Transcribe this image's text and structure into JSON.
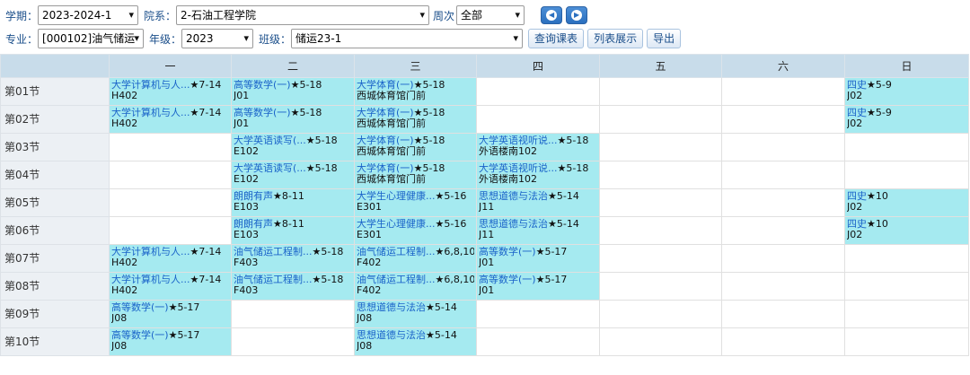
{
  "filters": {
    "term_label": "学期：",
    "term_value": "2023-2024-1",
    "dept_label": "院系：",
    "dept_value": "2-石油工程学院",
    "week_label": "周次",
    "week_value": "全部",
    "major_label": "专业：",
    "major_value": "[000102]油气储运",
    "grade_label": "年级：",
    "grade_value": "2023",
    "class_label": "班级：",
    "class_value": "储运23-1",
    "arrow": "▾"
  },
  "buttons": {
    "prev": "◀",
    "next": "▶",
    "query": "查询课表",
    "list": "列表展示",
    "export": "导出"
  },
  "timetable": {
    "days": [
      "",
      "一",
      "二",
      "三",
      "四",
      "五",
      "六",
      "日"
    ],
    "sections": [
      "第01节",
      "第02节",
      "第03节",
      "第04节",
      "第05节",
      "第06节",
      "第07节",
      "第08节",
      "第09节",
      "第10节"
    ],
    "rows": [
      [
        {
          "course": "大学计算机与人...",
          "weeks": "★7-14",
          "room": "H402"
        },
        {
          "course": "高等数学(一)",
          "weeks": "★5-18",
          "room": "J01"
        },
        {
          "course": "大学体育(一)",
          "weeks": "★5-18",
          "room": "西城体育馆门前"
        },
        null,
        null,
        null,
        {
          "course": "四史",
          "weeks": "★5-9",
          "room": "J02"
        }
      ],
      [
        {
          "course": "大学计算机与人...",
          "weeks": "★7-14",
          "room": "H402"
        },
        {
          "course": "高等数学(一)",
          "weeks": "★5-18",
          "room": "J01"
        },
        {
          "course": "大学体育(一)",
          "weeks": "★5-18",
          "room": "西城体育馆门前"
        },
        null,
        null,
        null,
        {
          "course": "四史",
          "weeks": "★5-9",
          "room": "J02"
        }
      ],
      [
        null,
        {
          "course": "大学英语读写(...",
          "weeks": "★5-18",
          "room": "E102"
        },
        {
          "course": "大学体育(一)",
          "weeks": "★5-18",
          "room": "西城体育馆门前"
        },
        {
          "course": "大学英语视听说...",
          "weeks": "★5-18",
          "room": "外语楼南102"
        },
        null,
        null,
        null
      ],
      [
        null,
        {
          "course": "大学英语读写(...",
          "weeks": "★5-18",
          "room": "E102"
        },
        {
          "course": "大学体育(一)",
          "weeks": "★5-18",
          "room": "西城体育馆门前"
        },
        {
          "course": "大学英语视听说...",
          "weeks": "★5-18",
          "room": "外语楼南102"
        },
        null,
        null,
        null
      ],
      [
        null,
        {
          "course": "朗朗有声",
          "weeks": "★8-11",
          "room": "E103"
        },
        {
          "course": "大学生心理健康...",
          "weeks": "★5-16",
          "room": "E301"
        },
        {
          "course": "思想道德与法治",
          "weeks": "★5-14",
          "room": "J11"
        },
        null,
        null,
        {
          "course": "四史",
          "weeks": "★10",
          "room": "J02"
        }
      ],
      [
        null,
        {
          "course": "朗朗有声",
          "weeks": "★8-11",
          "room": "E103"
        },
        {
          "course": "大学生心理健康...",
          "weeks": "★5-16",
          "room": "E301"
        },
        {
          "course": "思想道德与法治",
          "weeks": "★5-14",
          "room": "J11"
        },
        null,
        null,
        {
          "course": "四史",
          "weeks": "★10",
          "room": "J02"
        }
      ],
      [
        {
          "course": "大学计算机与人...",
          "weeks": "★7-14",
          "room": "H402"
        },
        {
          "course": "油气储运工程制...",
          "weeks": "★5-18",
          "room": "F403"
        },
        {
          "course": "油气储运工程制...",
          "weeks": "★6,8,10",
          "room": "F402"
        },
        {
          "course": "高等数学(一)",
          "weeks": "★5-17",
          "room": "J01"
        },
        null,
        null,
        null
      ],
      [
        {
          "course": "大学计算机与人...",
          "weeks": "★7-14",
          "room": "H402"
        },
        {
          "course": "油气储运工程制...",
          "weeks": "★5-18",
          "room": "F403"
        },
        {
          "course": "油气储运工程制...",
          "weeks": "★6,8,10",
          "room": "F402"
        },
        {
          "course": "高等数学(一)",
          "weeks": "★5-17",
          "room": "J01"
        },
        null,
        null,
        null
      ],
      [
        {
          "course": "高等数学(一)",
          "weeks": "★5-17",
          "room": "J08"
        },
        null,
        {
          "course": "思想道德与法治",
          "weeks": "★5-14",
          "room": "J08"
        },
        null,
        null,
        null,
        null
      ],
      [
        {
          "course": "高等数学(一)",
          "weeks": "★5-17",
          "room": "J08"
        },
        null,
        {
          "course": "思想道德与法治",
          "weeks": "★5-14",
          "room": "J08"
        },
        null,
        null,
        null,
        null
      ]
    ]
  },
  "colors": {
    "occupied_cell": "#a5eaf0",
    "header_bg": "#c8dcea",
    "link_blue": "#1a63c9"
  }
}
